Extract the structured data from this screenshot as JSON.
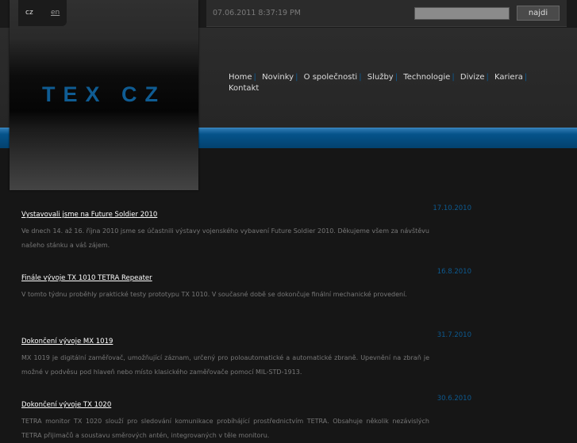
{
  "header": {
    "logo_text": "TEX CZ",
    "lang_cz": "cz",
    "lang_en": "en",
    "datetime": "07.06.2011 8:37:19 PM",
    "search_value": "",
    "search_button": "najdi"
  },
  "nav": {
    "items": [
      "Home",
      "Novinky",
      "O společnosti",
      "Služby",
      "Technologie",
      "Divize",
      "Kariera",
      "Kontakt"
    ]
  },
  "colors": {
    "accent": "#05538a",
    "date": "#0d5a90"
  },
  "articles": [
    {
      "title": "Vystavovali jsme na Future Soldier 2010",
      "date": "17.10.2010",
      "text": "Ve dnech 14. až 16. října 2010 jsme se účastnili výstavy vojenského vybavení Future Soldier 2010. Děkujeme všem za návštěvu našeho stánku a váš zájem."
    },
    {
      "title": "Finále vývoje TX 1010 TETRA Repeater",
      "date": "16.8.2010",
      "text": "V tomto týdnu proběhly praktické testy prototypu TX 1010. V současné době se dokončuje finální mechanické provedení."
    },
    {
      "title": "Dokončení vývoje MX 1019",
      "date": "31.7.2010",
      "text": "MX 1019 je digitální zaměřovač, umožňující záznam, určený pro poloautomatické a automatické zbraně. Upevnění na zbraň je možné v podvěsu pod hlaveň nebo místo klasického zaměřovače pomocí MIL-STD-1913."
    },
    {
      "title": "Dokončení vývoje TX 1020",
      "date": "30.6.2010",
      "text": "TETRA monitor TX 1020 slouží pro sledování komunikace probíhájící prostřednictvím TETRA. Obsahuje několik nezávislých TETRA přijimačů a soustavu směrových antén, integrovaných v těle monitoru."
    }
  ]
}
